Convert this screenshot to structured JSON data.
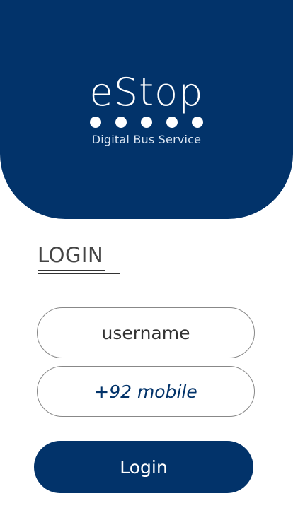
{
  "brand": {
    "name": "eStop",
    "tagline": "Digital Bus Service",
    "dot_count": 5
  },
  "login": {
    "heading": "LOGIN",
    "username_placeholder": "username",
    "mobile_placeholder": "+92 mobile",
    "button_label": "Login"
  },
  "colors": {
    "primary": "#02336a",
    "background": "#ffffff",
    "field_border": "#888888",
    "text": "#333333"
  }
}
